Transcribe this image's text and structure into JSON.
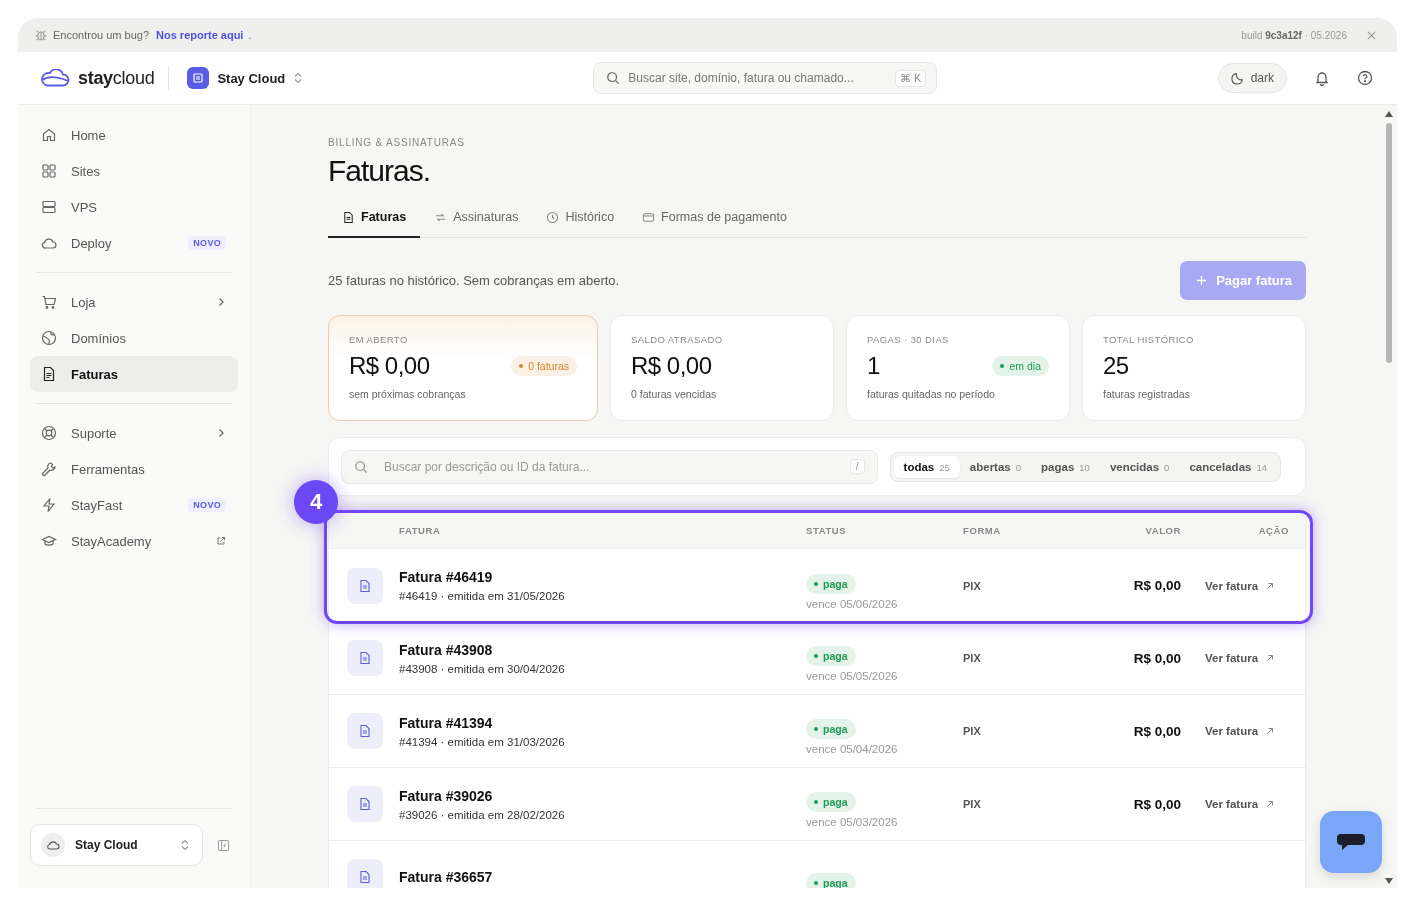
{
  "banner": {
    "text": "Encontrou um bug?",
    "link": "Nos reporte aqui",
    "suffix": ".",
    "build": "build **9c3a12f** · 05.2026"
  },
  "header": {
    "logo": "**stay**cloud",
    "workspace": "Stay Cloud",
    "search": {
      "placeholder": "Buscar site, domínio, fatura ou chamado...",
      "shortcut": "⌘ K"
    },
    "theme": "dark"
  },
  "sidebar": {
    "groups": [
      [
        {
          "label": "Home",
          "kind": "link",
          "selected": false
        },
        {
          "label": "Sites",
          "kind": "link",
          "selected": false
        },
        {
          "label": "VPS",
          "kind": "link",
          "selected": false
        },
        {
          "label": "Deploy",
          "kind": "link",
          "selected": false,
          "badge": "NOVO"
        }
      ],
      [
        {
          "label": "Loja",
          "kind": "submenu",
          "selected": false
        },
        {
          "label": "Domínios",
          "kind": "link",
          "selected": false
        },
        {
          "label": "Faturas",
          "kind": "link",
          "selected": true
        }
      ],
      [
        {
          "label": "Suporte",
          "kind": "submenu",
          "selected": false
        },
        {
          "label": "Ferramentas",
          "kind": "link",
          "selected": false
        },
        {
          "label": "StayFast",
          "kind": "link",
          "selected": false,
          "badge": "NOVO"
        },
        {
          "label": "StayAcademy",
          "kind": "external",
          "selected": false
        }
      ]
    ],
    "footer": {
      "workspace": "Stay Cloud"
    }
  },
  "page": {
    "breadcrumb": "BILLING & ASSINATURAS",
    "title": "Faturas.",
    "tabs": [
      {
        "label": "Faturas",
        "selected": true
      },
      {
        "label": "Assinaturas",
        "selected": false
      },
      {
        "label": "Histórico",
        "selected": false
      },
      {
        "label": "Formas de pagamento",
        "selected": false
      }
    ],
    "summary": "25 faturas no histórico. Sem cobranças em aberto.",
    "primary_button": {
      "label": "Pagar fatura",
      "disabled": true
    },
    "stats": [
      {
        "label": "EM ABERTO",
        "value": "R$ 0,00",
        "note": "sem próximas cobranças",
        "highlighted": true,
        "badge": {
          "text": "0 faturas",
          "color": "#d9822b"
        }
      },
      {
        "label": "SALDO ATRASADO",
        "value": "R$ 0,00",
        "note": "0 faturas vencidas",
        "highlighted": false
      },
      {
        "label": "PAGAS · 30 DIAS",
        "value": "1",
        "note": "faturas quitadas no período",
        "highlighted": false,
        "badge": {
          "text": "em dia",
          "color": "#1f9a55"
        }
      },
      {
        "label": "TOTAL HISTÓRICO",
        "value": "25",
        "note": "faturas registradas",
        "highlighted": false
      }
    ],
    "filter": {
      "placeholder": "Buscar por descrição ou ID da fatura...",
      "shortcut": "/",
      "chips": [
        {
          "label": "todas",
          "count": "25",
          "selected": true
        },
        {
          "label": "abertas",
          "count": "0",
          "selected": false
        },
        {
          "label": "pagas",
          "count": "10",
          "selected": false
        },
        {
          "label": "vencidas",
          "count": "0",
          "selected": false
        },
        {
          "label": "canceladas",
          "count": "14",
          "selected": false
        }
      ]
    },
    "table": {
      "columns": [
        "FATURA",
        "STATUS",
        "FORMA",
        "VALOR",
        "AÇÃO"
      ],
      "rows": [
        {
          "title": "Fatura #46419",
          "subtitle": "#46419 · emitida em 31/05/2026",
          "status": "paga",
          "color": "#1f9a55",
          "due": "vence 05/06/2026",
          "method": "PIX",
          "amount": "R$ 0,00",
          "action": "Ver fatura"
        },
        {
          "title": "Fatura #43908",
          "subtitle": "#43908 · emitida em 30/04/2026",
          "status": "paga",
          "color": "#1f9a55",
          "due": "vence 05/05/2026",
          "method": "PIX",
          "amount": "R$ 0,00",
          "action": "Ver fatura"
        },
        {
          "title": "Fatura #41394",
          "subtitle": "#41394 · emitida em 31/03/2026",
          "status": "paga",
          "color": "#1f9a55",
          "due": "vence 05/04/2026",
          "method": "PIX",
          "amount": "R$ 0,00",
          "action": "Ver fatura"
        },
        {
          "title": "Fatura #39026",
          "subtitle": "#39026 · emitida em 28/02/2026",
          "status": "paga",
          "color": "#1f9a55",
          "due": "vence 05/03/2026",
          "method": "PIX",
          "amount": "R$ 0,00",
          "action": "Ver fatura"
        },
        {
          "title": "Fatura #36657",
          "status": "paga",
          "color": "#1f9a55"
        }
      ]
    },
    "highlight": {
      "step": "4"
    }
  }
}
